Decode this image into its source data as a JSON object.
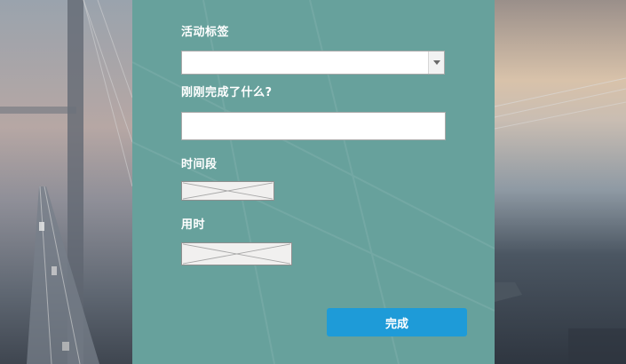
{
  "form": {
    "tag_label": "活动标签",
    "tag_value": "",
    "done_label": "刚刚完成了什么?",
    "done_value": "",
    "period_label": "时间段",
    "duration_label": "用时",
    "submit_label": "完成"
  },
  "icons": {
    "dropdown": "chevron-down-icon",
    "broken_image": "broken-image-icon"
  },
  "colors": {
    "panel": "#68a39e",
    "button": "#1e9bd8",
    "label_text": "#ffffff"
  }
}
